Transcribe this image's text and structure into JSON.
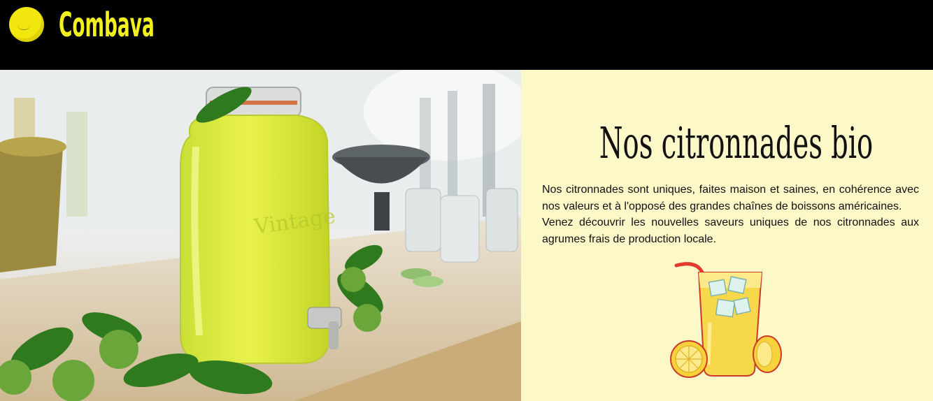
{
  "header": {
    "brand": "Combava",
    "logo_icon": "lemon-logo-icon"
  },
  "hero": {
    "image": "lemonade-dispenser-photo"
  },
  "content": {
    "title": "Nos citronnades bio",
    "paragraph1": "Nos citronnades sont uniques, faites maison et saines, en cohérence avec nos valeurs et à l'opposé des grandes chaînes de boissons américaines.",
    "paragraph2": "Venez découvrir les nouvelles saveurs uniques de nos citronnades aux agrumes frais de production locale.",
    "illustration": "lemonade-glass-icon"
  },
  "colors": {
    "header_bg": "#000000",
    "brand_yellow": "#f2ef1e",
    "panel_bg": "#fdf8c8"
  }
}
